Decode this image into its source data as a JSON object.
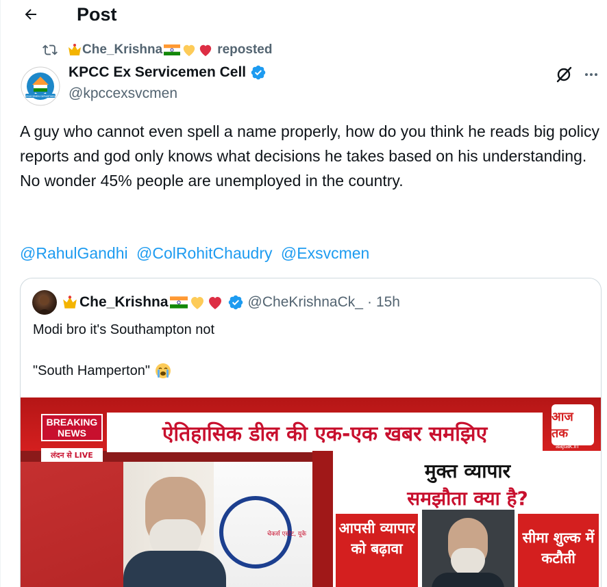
{
  "header": {
    "title": "Post",
    "back_icon": "arrow-left-icon"
  },
  "repost": {
    "reposter_name": "Che_Krishna",
    "reposter_emojis": [
      "crown",
      "india-flag",
      "yellow-heart",
      "red-heart"
    ],
    "label": "reposted"
  },
  "author": {
    "name": "KPCC Ex Servicemen Cell",
    "handle": "@kpccexsvcmen",
    "verified": true,
    "avatar_text": "SERVICEMEN DEPARTMENT"
  },
  "post": {
    "text": "A guy who cannot even spell a name properly, how do you think he reads big policy reports and god only knows what decisions he takes based on his understanding.  No wonder 45% people are unemployed in the country.",
    "mentions": [
      "@RahulGandhi",
      "@ColRohitChaudry",
      "@Exsvcmen"
    ]
  },
  "quote": {
    "name": "Che_Krishna",
    "handle": "@CheKrishnaCk_",
    "separator": "·",
    "time": "15h",
    "line1": "Modi bro it's Southampton not",
    "line2": "\"South Hamperton\"",
    "line2_emoji": "loudly-crying-face"
  },
  "media": {
    "breaking": "BREAKING NEWS",
    "location_tag": "लंदन से LIVE",
    "headline": "ऐतिहासिक डील की एक-एक खबर समझिए",
    "logo": "आज तक",
    "logo_sub": "aajtak.in",
    "caption": "चेकर्स एस्टेट, यूके",
    "panel_title1": "मुक्त व्यापार",
    "panel_title2": "समझौता क्या है?",
    "box_left": "आपसी व्यापार को बढ़ावा",
    "box_right": "सीमा शुल्क में कटौती"
  },
  "colors": {
    "text": "#0f1419",
    "secondary": "#536471",
    "link": "#1d9bf0",
    "verified": "#1d9bf0",
    "border": "#cfd9de"
  }
}
